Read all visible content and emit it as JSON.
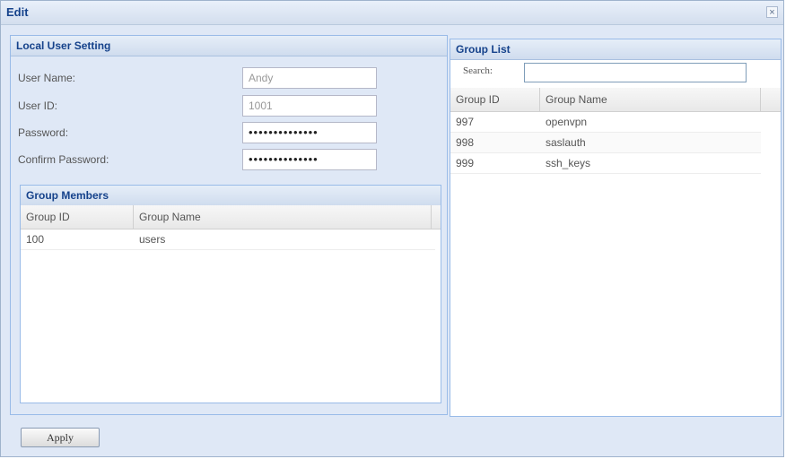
{
  "window": {
    "title": "Edit",
    "close_symbol": "×"
  },
  "local_user_setting": {
    "title": "Local User Setting",
    "fields": [
      {
        "label": "User Name:",
        "value": "Andy"
      },
      {
        "label": "User ID:",
        "value": "1001"
      },
      {
        "label": "Password:",
        "value": "••••••••••••••"
      },
      {
        "label": "Confirm Password:",
        "value": "••••••••••••••"
      }
    ]
  },
  "group_members": {
    "title": "Group Members",
    "columns": [
      "Group ID",
      "Group Name"
    ],
    "rows": [
      {
        "id": "100",
        "name": "users"
      }
    ]
  },
  "group_list": {
    "title": "Group List",
    "search_label": "Search:",
    "search_value": "",
    "columns": [
      "Group ID",
      "Group Name"
    ],
    "rows": [
      {
        "id": "997",
        "name": "openvpn"
      },
      {
        "id": "998",
        "name": "saslauth"
      },
      {
        "id": "999",
        "name": "ssh_keys"
      }
    ]
  },
  "footer": {
    "apply_label": "Apply"
  }
}
